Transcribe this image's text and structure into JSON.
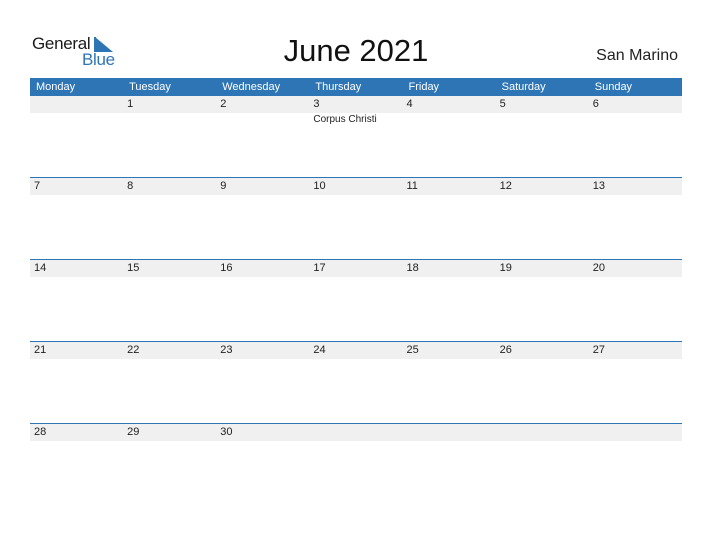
{
  "logo": {
    "word1": "General",
    "word2": "Blue"
  },
  "header": {
    "title": "June 2021",
    "country": "San Marino"
  },
  "colors": {
    "accent": "#2e75b6",
    "strip": "#f0f0f0"
  },
  "days": [
    "Monday",
    "Tuesday",
    "Wednesday",
    "Thursday",
    "Friday",
    "Saturday",
    "Sunday"
  ],
  "weeks": [
    {
      "dates": [
        "",
        "1",
        "2",
        "3",
        "4",
        "5",
        "6"
      ],
      "events": [
        "",
        "",
        "",
        "Corpus Christi",
        "",
        "",
        ""
      ]
    },
    {
      "dates": [
        "7",
        "8",
        "9",
        "10",
        "11",
        "12",
        "13"
      ],
      "events": [
        "",
        "",
        "",
        "",
        "",
        "",
        ""
      ]
    },
    {
      "dates": [
        "14",
        "15",
        "16",
        "17",
        "18",
        "19",
        "20"
      ],
      "events": [
        "",
        "",
        "",
        "",
        "",
        "",
        ""
      ]
    },
    {
      "dates": [
        "21",
        "22",
        "23",
        "24",
        "25",
        "26",
        "27"
      ],
      "events": [
        "",
        "",
        "",
        "",
        "",
        "",
        ""
      ]
    },
    {
      "dates": [
        "28",
        "29",
        "30",
        "",
        "",
        "",
        ""
      ],
      "events": [
        "",
        "",
        "",
        "",
        "",
        "",
        ""
      ]
    }
  ]
}
